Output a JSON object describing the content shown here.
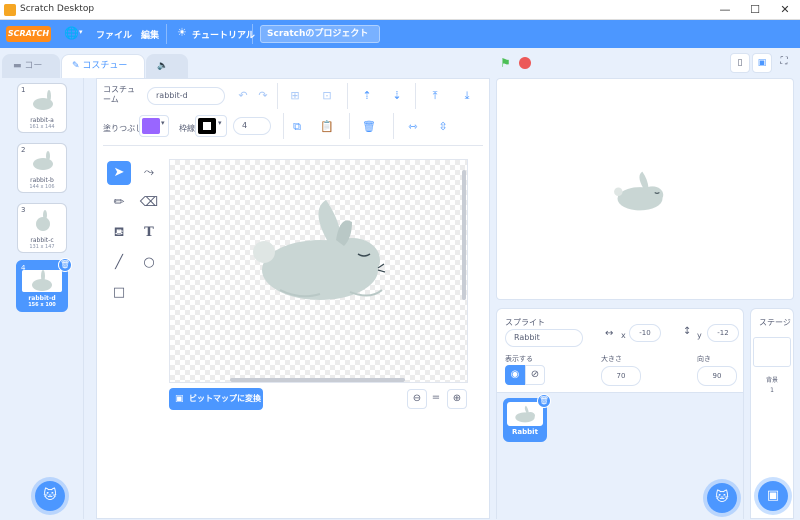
{
  "window": {
    "title": "Scratch Desktop",
    "minimize": "—",
    "maximize": "☐",
    "close": "✕"
  },
  "menubar": {
    "logo": "SCRATCH",
    "file": "ファイル",
    "edit": "編集",
    "tutorial": "チュートリアル",
    "project_name": "Scratchのプロジェクト"
  },
  "tabs": {
    "code": "コード",
    "costume": "コスチューム",
    "sound": "音"
  },
  "costumes": [
    {
      "num": "1",
      "name": "rabbit-a",
      "size": "161 x 144"
    },
    {
      "num": "2",
      "name": "rabbit-b",
      "size": "144 x 106"
    },
    {
      "num": "3",
      "name": "rabbit-c",
      "size": "131 x 147"
    },
    {
      "num": "4",
      "name": "rabbit-d",
      "size": "156 x 100"
    }
  ],
  "editor": {
    "costume_label": "コスチューム",
    "costume_name": "rabbit-d",
    "fill_label": "塗りつぶし",
    "outline_label": "枠線",
    "outline_width": "4",
    "fill_color": "#9966ff",
    "convert_button": "ビットマップに変換"
  },
  "sprite": {
    "label": "スプライト",
    "name": "Rabbit",
    "x_label": "x",
    "x": "-10",
    "y_label": "y",
    "y": "-12",
    "show_label": "表示する",
    "size_label": "大きさ",
    "size": "70",
    "direction_label": "向き",
    "direction": "90",
    "tile_name": "Rabbit"
  },
  "stage_panel": {
    "label": "ステージ",
    "backdrops_label": "背景",
    "backdrops_count": "1"
  },
  "colors": {
    "accent": "#4c97ff",
    "menubar": "#4c97ff",
    "green_flag": "#4cbf56",
    "stop": "#ec5959",
    "rabbit": "#c9d6d4"
  }
}
